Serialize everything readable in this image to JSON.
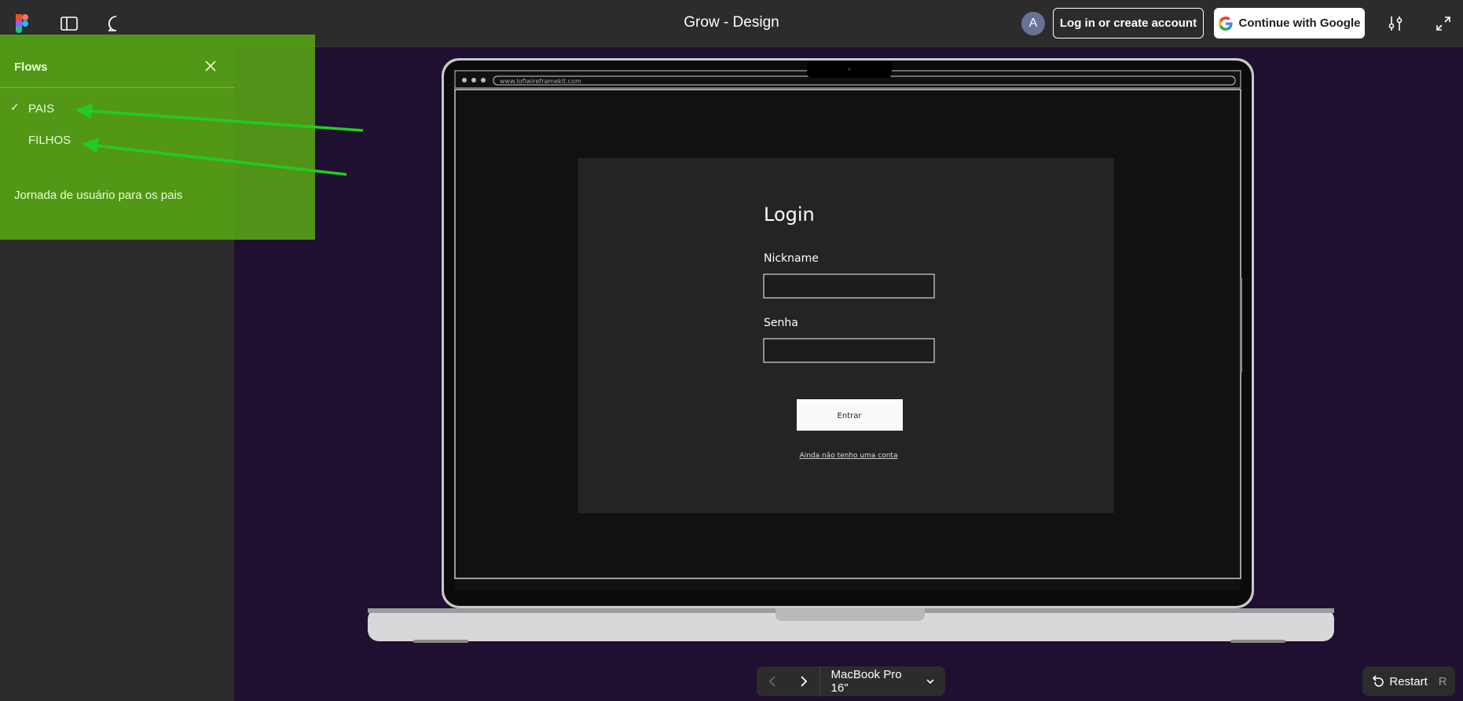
{
  "header": {
    "title": "Grow - Design",
    "avatar_initial": "A",
    "login_label": "Log in or create account",
    "google_label": "Continue with Google"
  },
  "flows": {
    "heading": "Flows",
    "items": [
      {
        "label": "PAIS",
        "selected": true
      },
      {
        "label": "FILHOS",
        "selected": false
      }
    ],
    "description": "Jornada de usuário para os pais"
  },
  "prototype": {
    "url": "www.lofiwireframekit.com",
    "login_title": "Login",
    "nickname_label": "Nickname",
    "password_label": "Senha",
    "submit_label": "Entrar",
    "signup_link": "Ainda não tenho uma conta"
  },
  "footer": {
    "device_label": "MacBook Pro 16\"",
    "restart_label": "Restart",
    "restart_shortcut": "R"
  },
  "colors": {
    "canvas": "#1f0f30",
    "flows_overlay": "#5aaa14",
    "annotation_arrow": "#22cc22"
  }
}
